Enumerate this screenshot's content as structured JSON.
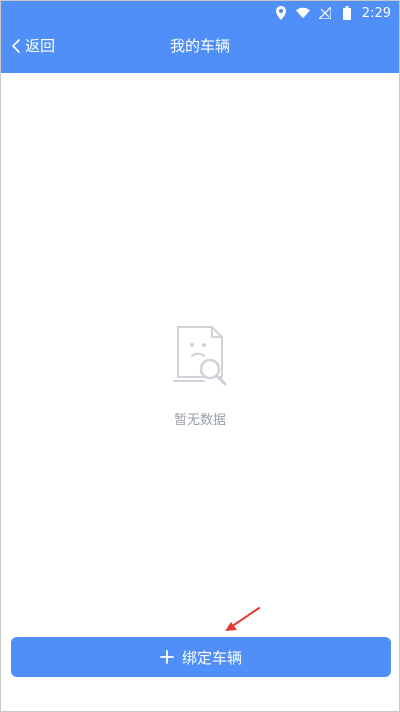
{
  "statusbar": {
    "time": "2:29",
    "icons": [
      "location-icon",
      "wifi-icon",
      "signal-icon",
      "battery-icon"
    ]
  },
  "header": {
    "back_label": "返回",
    "title": "我的车辆"
  },
  "empty_state": {
    "message": "暂无数据",
    "icon": "no-data-icon"
  },
  "footer": {
    "button_label": "绑定车辆",
    "button_icon": "plus-icon"
  },
  "colors": {
    "primary": "#4f8ff7",
    "text_muted": "#9aa0a6",
    "annotation_arrow": "#e53935"
  }
}
